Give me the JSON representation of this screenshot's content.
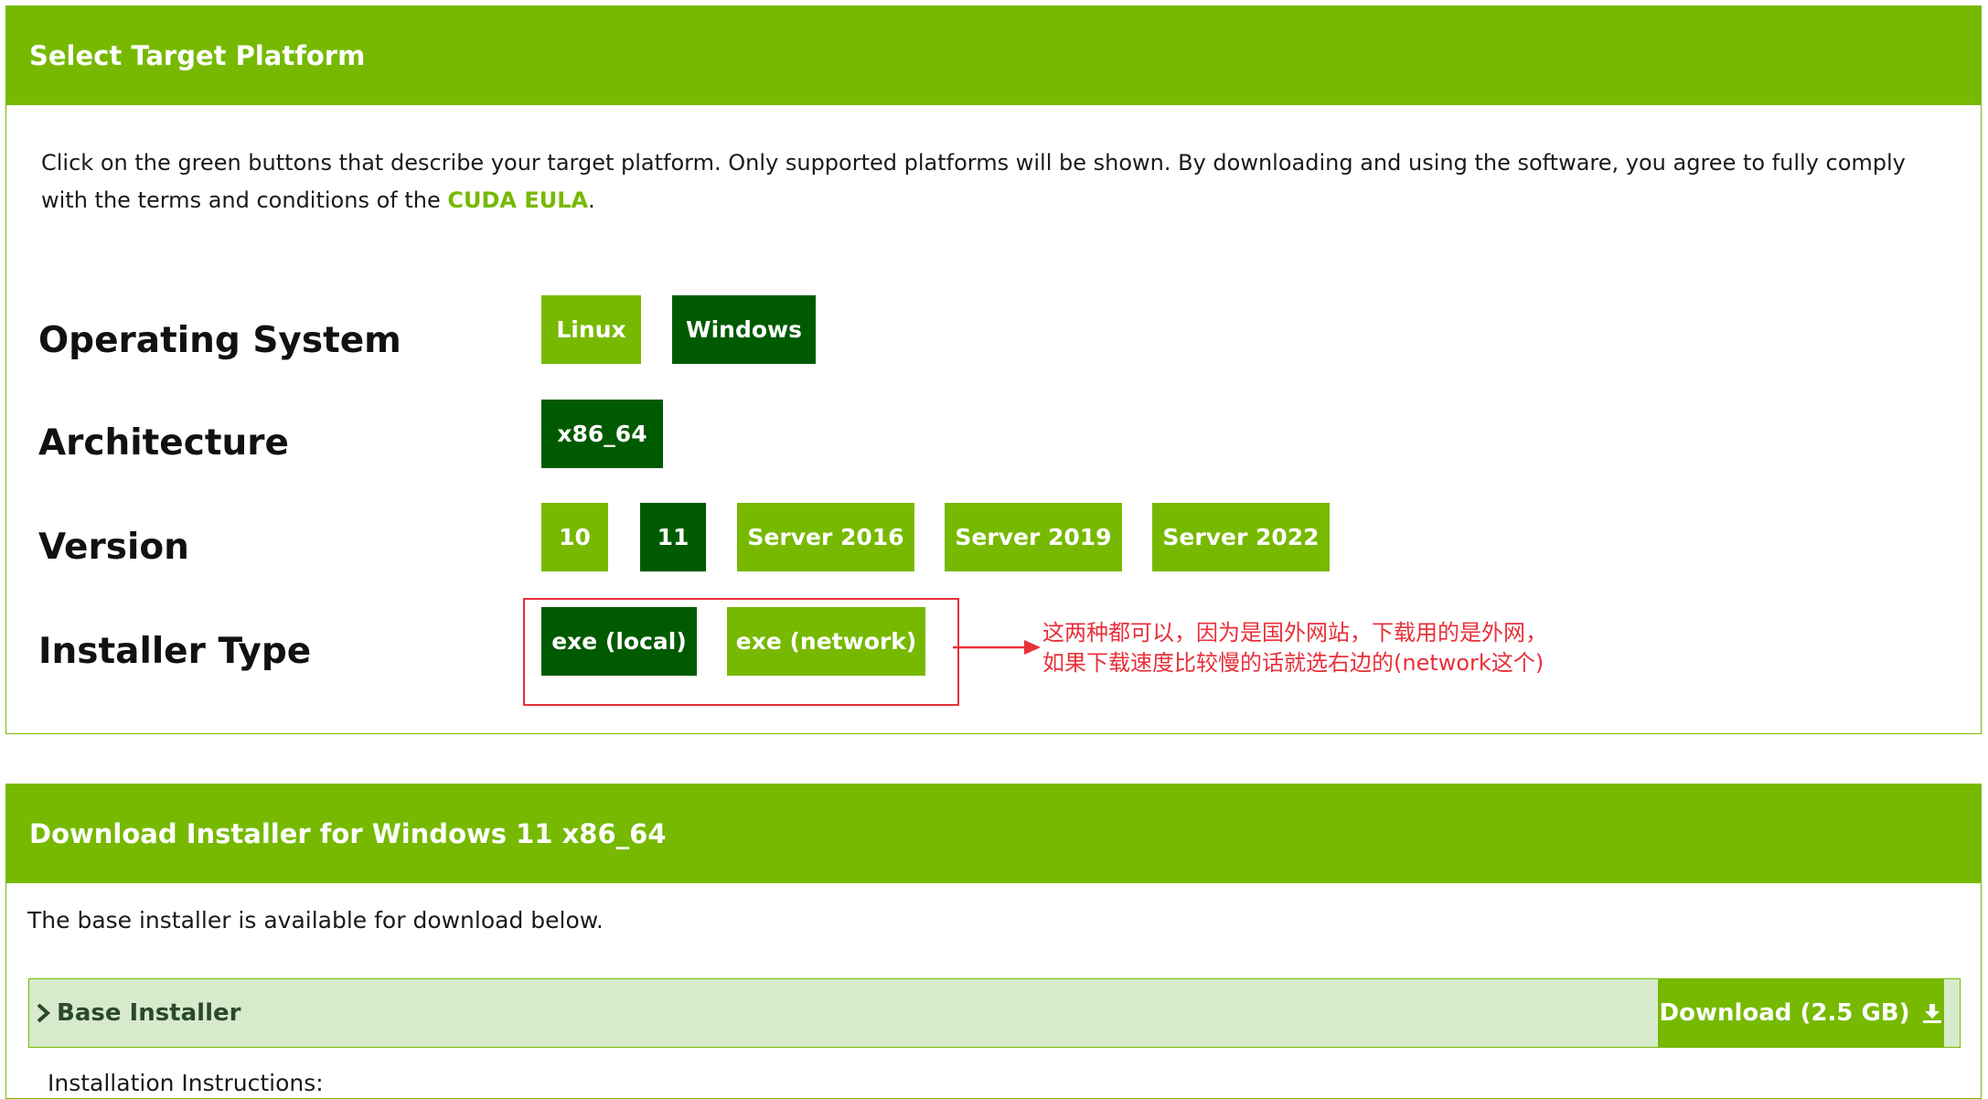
{
  "platform": {
    "header": "Select Target Platform",
    "intro_text": "Click on the green buttons that describe your target platform. Only supported platforms will be shown. By downloading and using the software, you agree to fully comply with the terms and conditions of the",
    "eula_link": "CUDA EULA",
    "intro_end": ".",
    "os": {
      "label": "Operating System",
      "options": [
        "Linux",
        "Windows"
      ],
      "selected": "Windows"
    },
    "arch": {
      "label": "Architecture",
      "options": [
        "x86_64"
      ],
      "selected": "x86_64"
    },
    "version": {
      "label": "Version",
      "options": [
        "10",
        "11",
        "Server 2016",
        "Server 2019",
        "Server 2022"
      ],
      "selected": "11"
    },
    "installer": {
      "label": "Installer Type",
      "options": [
        "exe (local)",
        "exe (network)"
      ],
      "selected": "exe (local)"
    }
  },
  "annotation": {
    "line1": "这两种都可以，因为是国外网站，下载用的是外网，",
    "line2": "如果下载速度比较慢的话就选右边的(network这个)",
    "color": "#e8303a"
  },
  "download": {
    "header": "Download Installer for Windows 11 x86_64",
    "base_text": "The base installer is available for download below.",
    "base_label": "Base Installer",
    "button_label": "Download (2.5 GB)",
    "instructions": "Installation Instructions:"
  },
  "colors": {
    "accent": "#76b900",
    "selected": "#005a00",
    "light_bg": "#d7ebcc"
  }
}
